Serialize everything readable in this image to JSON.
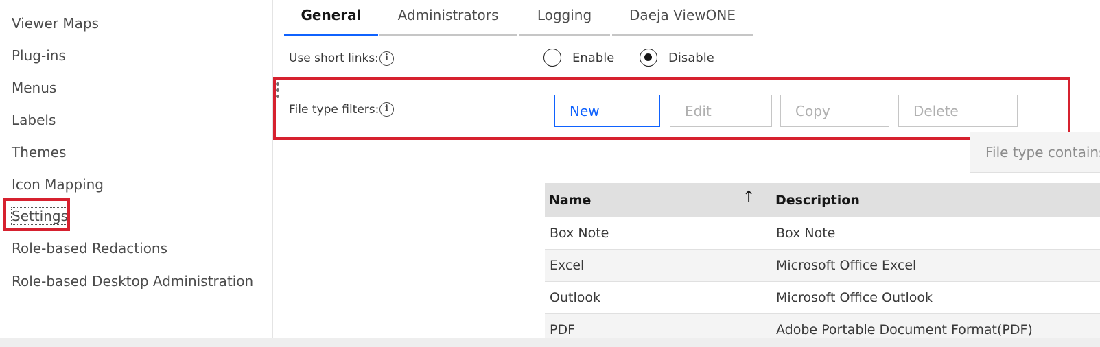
{
  "sidebar": {
    "items": [
      {
        "label": "Viewer Maps"
      },
      {
        "label": "Plug-ins"
      },
      {
        "label": "Menus"
      },
      {
        "label": "Labels"
      },
      {
        "label": "Themes"
      },
      {
        "label": "Icon Mapping"
      },
      {
        "label": "Settings"
      },
      {
        "label": "Role-based Redactions"
      },
      {
        "label": "Role-based Desktop Administration"
      }
    ]
  },
  "tabs": [
    {
      "label": "General"
    },
    {
      "label": "Administrators"
    },
    {
      "label": "Logging"
    },
    {
      "label": "Daeja ViewONE"
    }
  ],
  "short_links": {
    "label": "Use short links:",
    "enable_label": "Enable",
    "disable_label": "Disable",
    "selected": "Disable"
  },
  "file_type_filters": {
    "label": "File type filters:",
    "buttons": {
      "new": "New",
      "edit": "Edit",
      "copy": "Copy",
      "delete": "Delete"
    },
    "filter_placeholder": "File type contains"
  },
  "table": {
    "columns": [
      "Name",
      "Description"
    ],
    "sort_icon": "arrow-up-icon",
    "rows": [
      {
        "name": "Box Note",
        "description": "Box Note"
      },
      {
        "name": "Excel",
        "description": "Microsoft Office Excel"
      },
      {
        "name": "Outlook",
        "description": "Microsoft Office Outlook"
      },
      {
        "name": "PDF",
        "description": "Adobe Portable Document Format(PDF)"
      }
    ]
  },
  "colors": {
    "accent": "#0f62fe",
    "highlight_box": "#d6212f"
  }
}
